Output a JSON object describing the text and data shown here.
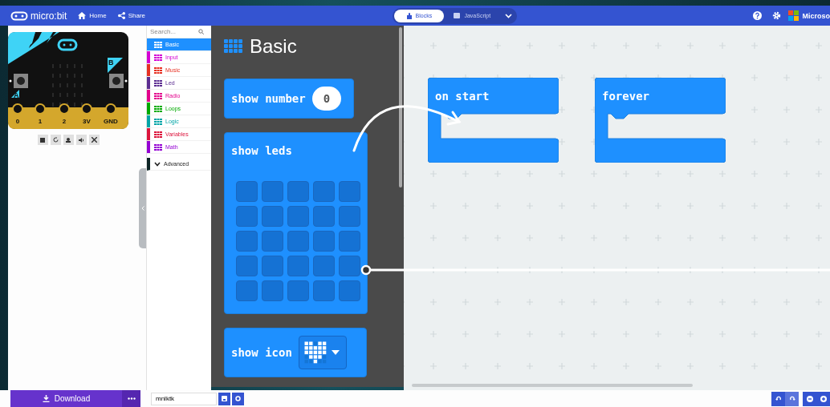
{
  "header": {
    "logo": "micro:bit",
    "nav": [
      {
        "label": "Home"
      },
      {
        "label": "Share"
      }
    ],
    "editor_tabs": [
      {
        "label": "Blocks",
        "selected": true
      },
      {
        "label": "JavaScript",
        "selected": false
      }
    ],
    "brand": "Microso"
  },
  "simulator": {
    "pins": [
      "0",
      "1",
      "2",
      "3V",
      "GND"
    ],
    "button_labels": [
      "A",
      "B"
    ]
  },
  "toolbox": {
    "search": {
      "placeholder": "Search..."
    },
    "categories": [
      {
        "label": "Basic",
        "color": "#1e90ff",
        "selected": true
      },
      {
        "label": "Input",
        "color": "#d400d4",
        "selected": false
      },
      {
        "label": "Music",
        "color": "#e63022",
        "selected": false
      },
      {
        "label": "Led",
        "color": "#5c2d91",
        "selected": false
      },
      {
        "label": "Radio",
        "color": "#e3008c",
        "selected": false
      },
      {
        "label": "Loops",
        "color": "#00aa00",
        "selected": false
      },
      {
        "label": "Logic",
        "color": "#00a4a6",
        "selected": false
      },
      {
        "label": "Variables",
        "color": "#dc143c",
        "selected": false
      },
      {
        "label": "Math",
        "color": "#9400d3",
        "selected": false
      }
    ],
    "advanced": {
      "label": "Advanced",
      "expanded": false
    }
  },
  "flyout": {
    "title": "Basic",
    "blocks": [
      {
        "kind": "number",
        "label": "show number",
        "value": "0"
      },
      {
        "kind": "leds",
        "label": "show leds",
        "leds": [
          {
            "on": false
          },
          {
            "on": false
          },
          {
            "on": false
          },
          {
            "on": false
          },
          {
            "on": false
          },
          {
            "on": false
          },
          {
            "on": false
          },
          {
            "on": false
          },
          {
            "on": false
          },
          {
            "on": false
          },
          {
            "on": false
          },
          {
            "on": false
          },
          {
            "on": false
          },
          {
            "on": false
          },
          {
            "on": false
          },
          {
            "on": false
          },
          {
            "on": false
          },
          {
            "on": false
          },
          {
            "on": false
          },
          {
            "on": false
          },
          {
            "on": false
          },
          {
            "on": false
          },
          {
            "on": false
          },
          {
            "on": false
          },
          {
            "on": false
          }
        ]
      },
      {
        "kind": "icon",
        "label": "show icon"
      }
    ]
  },
  "workspace": {
    "blocks": [
      {
        "label": "on start"
      },
      {
        "label": "forever"
      }
    ]
  },
  "footer": {
    "download": "Download",
    "project_name": "mnlktk"
  }
}
